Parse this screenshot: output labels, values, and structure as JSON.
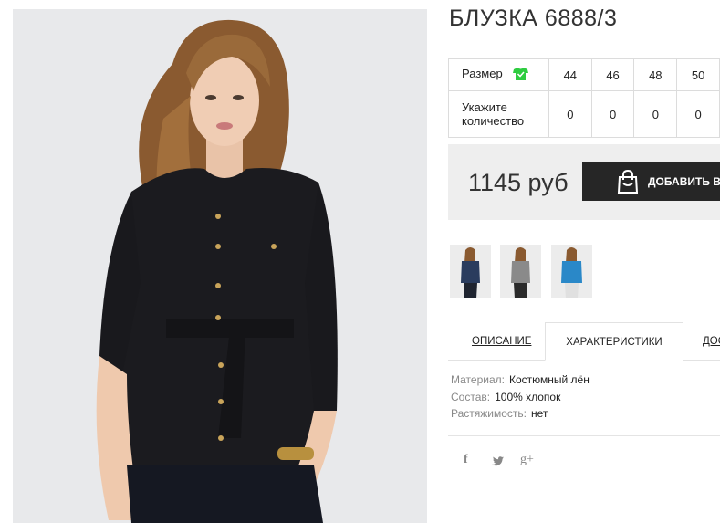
{
  "product": {
    "title": "БЛУЗКА 6888/3"
  },
  "sizes": {
    "size_label": "Размер",
    "qty_label": "Укажите количество",
    "values": [
      "44",
      "46",
      "48",
      "50"
    ],
    "quantities": [
      "0",
      "0",
      "0",
      "0"
    ],
    "accent": "#2ecc40"
  },
  "purchase": {
    "price": "1145 руб",
    "add_to_cart": "ДОБАВИТЬ В З",
    "button_color": "#262626"
  },
  "tabs": {
    "description": "ОПИСАНИЕ",
    "characteristics": "ХАРАКТЕРИСТИКИ",
    "delivery": "ДОС"
  },
  "specs": [
    {
      "key": "Материал:",
      "value": "Костюмный лён"
    },
    {
      "key": "Состав:",
      "value": "100% хлопок"
    },
    {
      "key": "Растяжимость:",
      "value": "нет"
    }
  ],
  "thumbnails": [
    {
      "color": "#2a3c5e"
    },
    {
      "color": "#8a8a8a"
    },
    {
      "color": "#2a88c8"
    }
  ],
  "social": {
    "facebook": "f",
    "twitter": "twitter-icon",
    "gplus": "g+"
  }
}
